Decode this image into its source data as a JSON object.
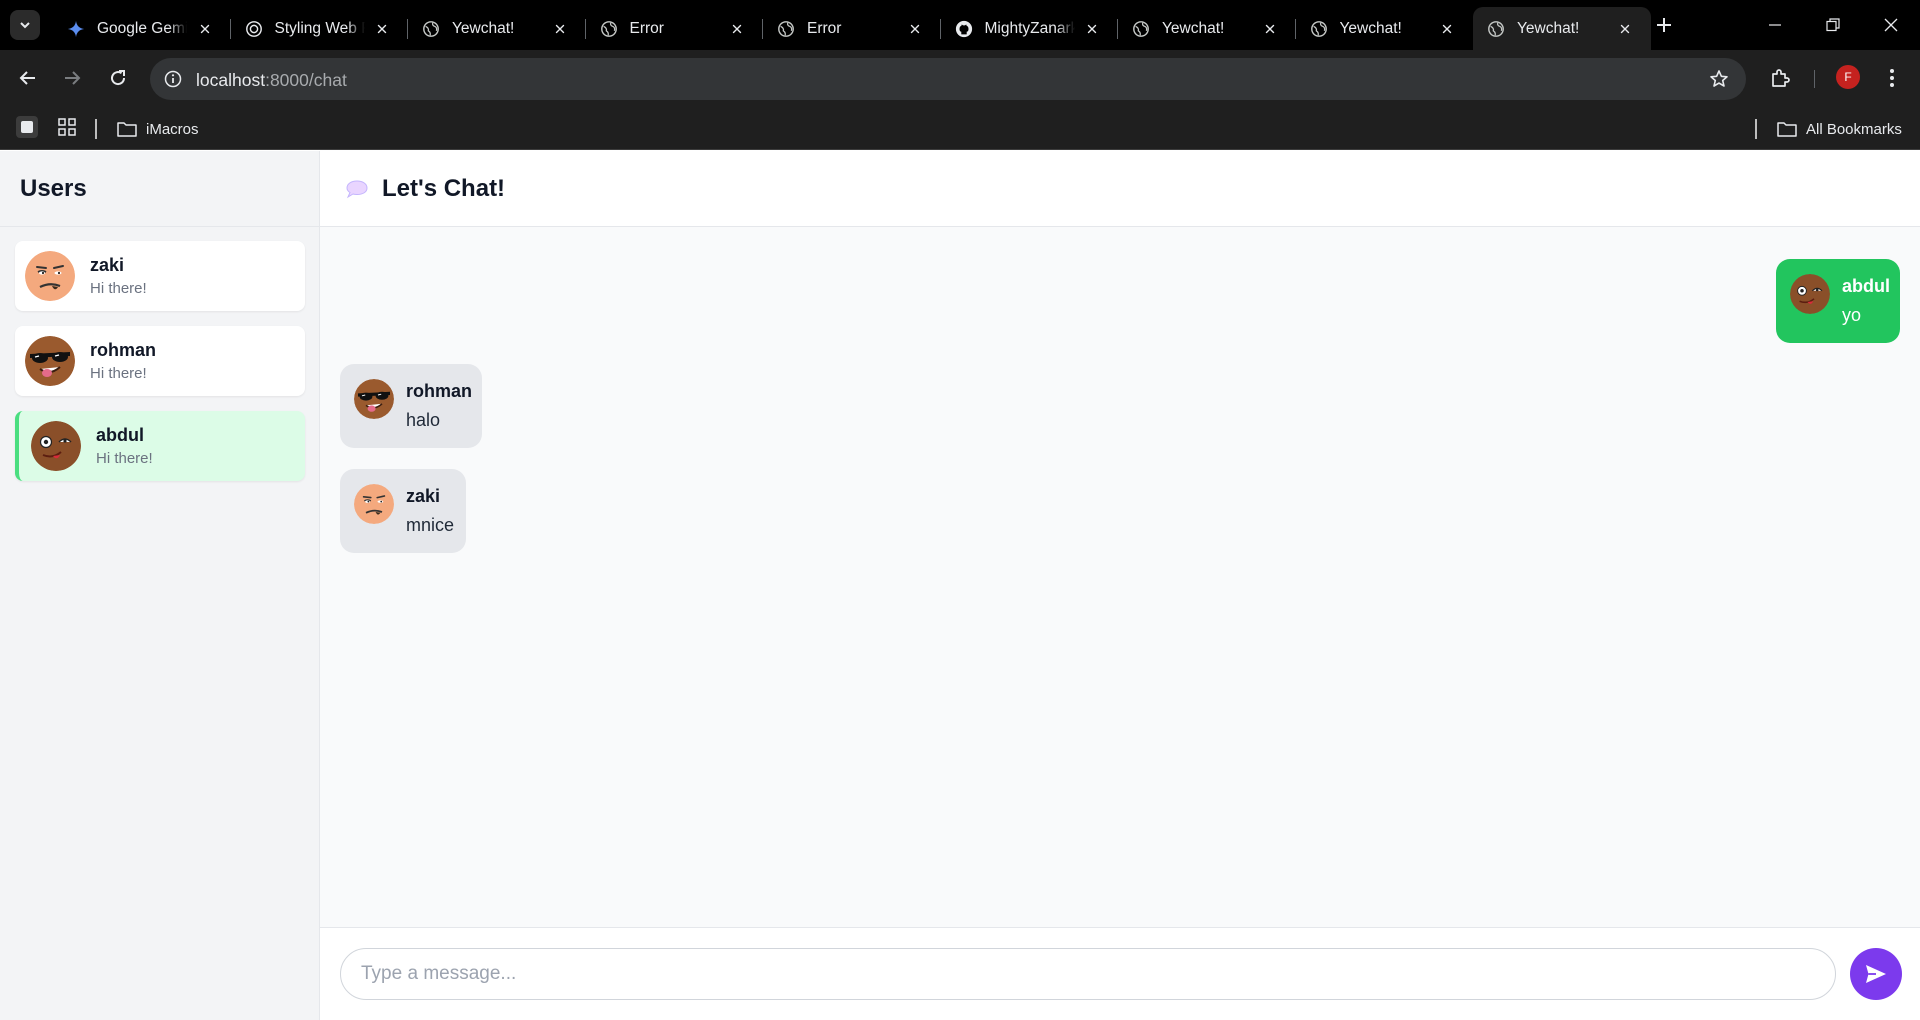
{
  "browser": {
    "tabs": [
      {
        "title": "Google Gemini",
        "icon": "gemini-icon"
      },
      {
        "title": "Styling Web Pages",
        "icon": "openai-icon"
      },
      {
        "title": "Yewchat!",
        "icon": "globe-icon"
      },
      {
        "title": "Error",
        "icon": "globe-icon"
      },
      {
        "title": "Error",
        "icon": "globe-icon"
      },
      {
        "title": "MightyZanark",
        "icon": "github-icon"
      },
      {
        "title": "Yewchat!",
        "icon": "globe-icon"
      },
      {
        "title": "Yewchat!",
        "icon": "globe-icon"
      },
      {
        "title": "Yewchat!",
        "icon": "globe-icon",
        "active": true
      }
    ],
    "url_host": "localhost",
    "url_path": ":8000/chat",
    "profile_initial": "F",
    "bookmarks": [
      {
        "label": "iMacros",
        "icon": "folder-icon"
      }
    ],
    "all_bookmarks_label": "All Bookmarks"
  },
  "sidebar": {
    "title": "Users",
    "users": [
      {
        "name": "zaki",
        "status": "Hi there!",
        "avatar": "zaki-avatar",
        "active": false
      },
      {
        "name": "rohman",
        "status": "Hi there!",
        "avatar": "rohman-avatar",
        "active": false
      },
      {
        "name": "abdul",
        "status": "Hi there!",
        "avatar": "abdul-avatar",
        "active": true
      }
    ]
  },
  "chat": {
    "title": "Let's Chat!",
    "title_icon": "speech-bubble-icon",
    "messages": [
      {
        "author": "abdul",
        "text": "yo",
        "mine": true
      },
      {
        "author": "rohman",
        "text": "halo",
        "mine": false
      },
      {
        "author": "zaki",
        "text": "mnice",
        "mine": false
      }
    ],
    "input_placeholder": "Type a message...",
    "input_value": "",
    "send_icon": "send-icon"
  },
  "colors": {
    "accent_send": "#7c3aed",
    "my_message": "#22c55e",
    "active_user_bg": "#dcfce7",
    "active_user_border": "#4ade80"
  }
}
